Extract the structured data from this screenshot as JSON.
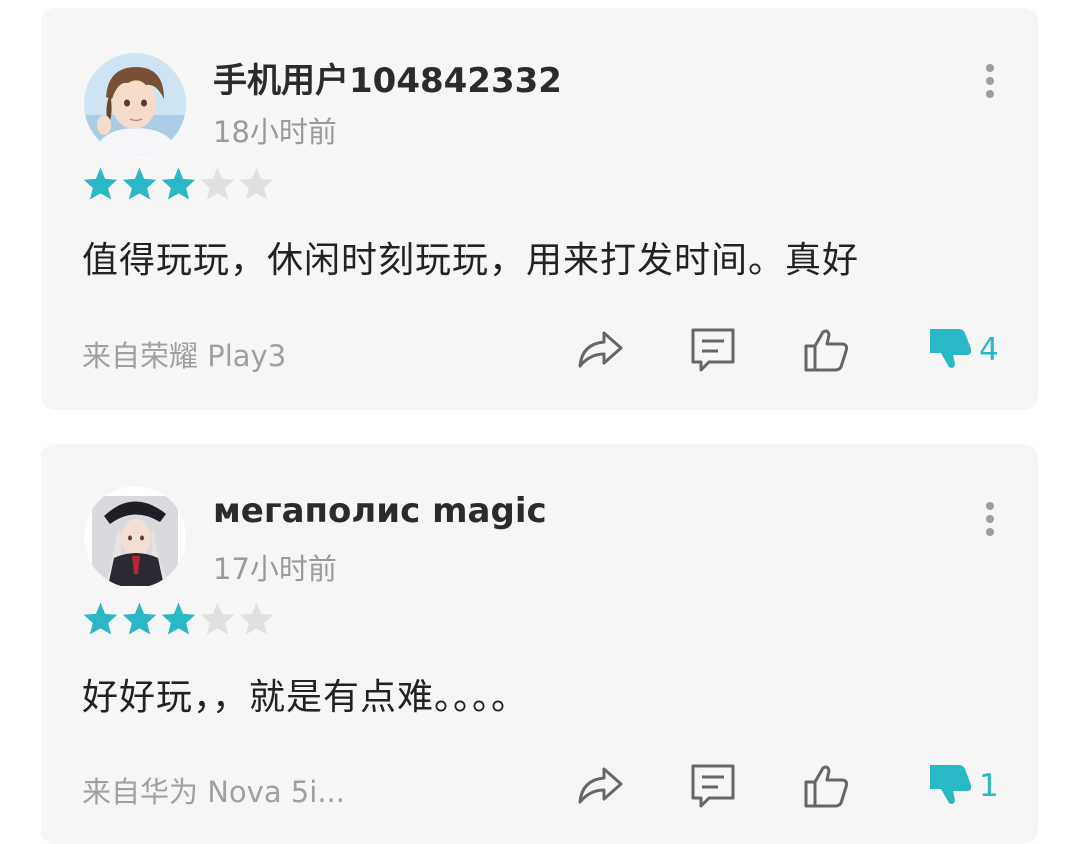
{
  "colors": {
    "accent": "#2bb8c6",
    "star_filled": "#2bb8c6",
    "star_empty": "#e0e0e0",
    "icon_gray": "#666666",
    "card_bg": "#f6f6f6"
  },
  "reviews": [
    {
      "username": "手机用户104842332",
      "time": "18小时前",
      "rating": 3,
      "max_rating": 5,
      "content": "值得玩玩，休闲时刻玩玩，用来打发时间。真好",
      "device": "来自荣耀 Play3",
      "dislike_count": "4",
      "icons": [
        "share-icon",
        "comment-icon",
        "thumbs-up-icon",
        "thumbs-down-icon"
      ]
    },
    {
      "username": "мегаполис magic",
      "time": "17小时前",
      "rating": 3,
      "max_rating": 5,
      "content": "好好玩，，就是有点难。。。。",
      "device": "来自华为 Nova 5i...",
      "dislike_count": "1",
      "icons": [
        "share-icon",
        "comment-icon",
        "thumbs-up-icon",
        "thumbs-down-icon"
      ]
    }
  ]
}
